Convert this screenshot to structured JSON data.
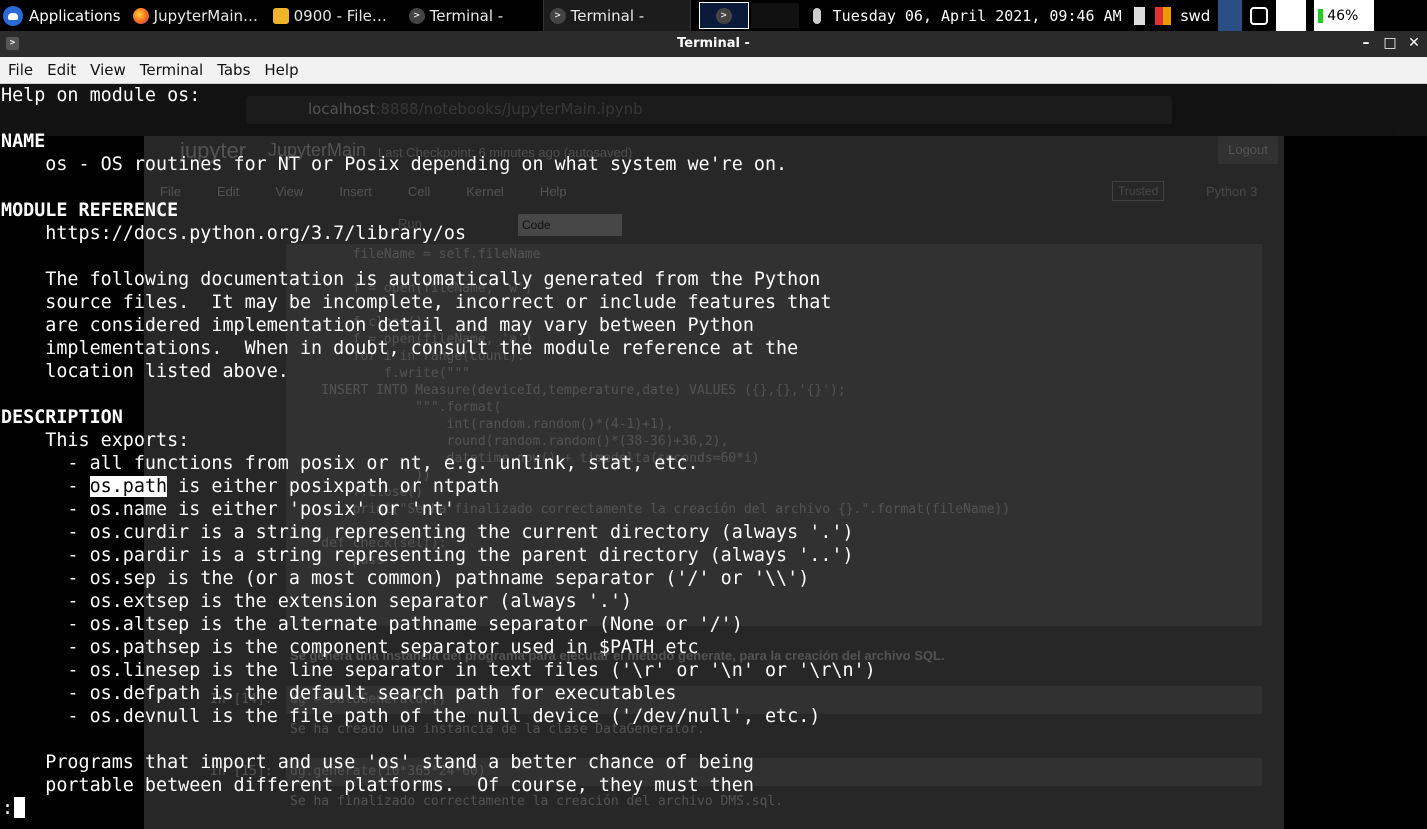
{
  "panel": {
    "applications_label": "Applications",
    "tasks": [
      {
        "label": "JupyterMain…",
        "icon": "firefox-icon"
      },
      {
        "label": "0900 - File…",
        "icon": "folder-icon"
      },
      {
        "label": "Terminal -",
        "icon": "terminal-icon"
      },
      {
        "label": "Terminal -",
        "icon": "terminal-icon"
      }
    ],
    "clock": "Tuesday 06, April 2021, 09:46 AM",
    "user": "swd",
    "battery": "46%"
  },
  "window": {
    "title": "Terminal -",
    "minimize_glyph": "–",
    "maximize_glyph": "□",
    "close_glyph": "✕"
  },
  "menu": {
    "file": "File",
    "edit": "Edit",
    "view": "View",
    "terminal": "Terminal",
    "tabs": "Tabs",
    "help": "Help"
  },
  "background_browser": {
    "url_host": "localhost",
    "url_rest": ":8888/notebooks/JupyterMain.ipynb",
    "brand": "jupyter",
    "notebook_name": "JupyterMain",
    "checkpoint": "Last Checkpoint: 6 minutes ago  (autosaved)",
    "logout": "Logout",
    "nb_menu": [
      "File",
      "Edit",
      "View",
      "Insert",
      "Cell",
      "Kernel",
      "Help"
    ],
    "trusted": "Trusted",
    "kernel": "Python 3",
    "run_label": "Run",
    "cell_type": "Code",
    "code": "        fileName = self.fileName\n\n        f = open(fileName, 'w')\n\n        f.close()\n        f = open(fileName, 'a')\n        for i in range(count):\n            f.write(\"\"\"\n    INSERT INTO Measure(deviceId,temperature,date) VALUES ({},{},'{}');\n                \"\"\".format(\n                    int(random.random()*(4-1)+1),\n                    round(random.random()*(38-36)+36,2),\n                    datetime.now() + timedelta(seconds=60*i)\n                ))\n        f.close()\n        print(\"Se ha finalizado correctamente la creación del archivo {}.\".format(fileName))\n\n    def check(self):\n        pass",
    "markdown": "Se genera una instancia del programa para ejecutar el método generate, para la creación del archivo SQL.",
    "in14_prompt": "In [14]:",
    "in14_code": "dg = DataGenerator()",
    "out14": "Se ha creado una instancia de la clase DataGenerator.",
    "in15_prompt": "In [15]:",
    "in15_code": "dg.generate(10*365*24*60)",
    "out15": "Se ha finalizado correctamente la creación del archivo DMS.sql."
  },
  "man_page": {
    "lines": [
      {
        "text": "Help on module os:",
        "bold": false
      },
      {
        "text": "",
        "bold": false
      },
      {
        "text": "NAME",
        "bold": true
      },
      {
        "text": "    os - OS routines for NT or Posix depending on what system we're on.",
        "bold": false
      },
      {
        "text": "",
        "bold": false
      },
      {
        "text": "MODULE REFERENCE",
        "bold": true
      },
      {
        "text": "    https://docs.python.org/3.7/library/os",
        "bold": false
      },
      {
        "text": "",
        "bold": false
      },
      {
        "text": "    The following documentation is automatically generated from the Python",
        "bold": false
      },
      {
        "text": "    source files.  It may be incomplete, incorrect or include features that",
        "bold": false
      },
      {
        "text": "    are considered implementation detail and may vary between Python",
        "bold": false
      },
      {
        "text": "    implementations.  When in doubt, consult the module reference at the",
        "bold": false
      },
      {
        "text": "    location listed above.",
        "bold": false
      },
      {
        "text": "",
        "bold": false
      },
      {
        "text": "DESCRIPTION",
        "bold": true
      },
      {
        "text": "    This exports:",
        "bold": false
      },
      {
        "text": "      - all functions from posix or nt, e.g. unlink, stat, etc.",
        "bold": false
      },
      {
        "text": "      - os.path is either posixpath or ntpath",
        "bold": false,
        "highlight": "os.path"
      },
      {
        "text": "      - os.name is either 'posix' or 'nt'",
        "bold": false
      },
      {
        "text": "      - os.curdir is a string representing the current directory (always '.')",
        "bold": false
      },
      {
        "text": "      - os.pardir is a string representing the parent directory (always '..')",
        "bold": false
      },
      {
        "text": "      - os.sep is the (or a most common) pathname separator ('/' or '\\\\')",
        "bold": false
      },
      {
        "text": "      - os.extsep is the extension separator (always '.')",
        "bold": false
      },
      {
        "text": "      - os.altsep is the alternate pathname separator (None or '/')",
        "bold": false
      },
      {
        "text": "      - os.pathsep is the component separator used in $PATH etc",
        "bold": false
      },
      {
        "text": "      - os.linesep is the line separator in text files ('\\r' or '\\n' or '\\r\\n')",
        "bold": false
      },
      {
        "text": "      - os.defpath is the default search path for executables",
        "bold": false
      },
      {
        "text": "      - os.devnull is the file path of the null device ('/dev/null', etc.)",
        "bold": false
      },
      {
        "text": "",
        "bold": false
      },
      {
        "text": "    Programs that import and use 'os' stand a better chance of being",
        "bold": false
      },
      {
        "text": "    portable between different platforms.  Of course, they must then",
        "bold": false
      }
    ],
    "pager_prompt": ":"
  },
  "colors": {
    "terminal_bg": "#000000",
    "terminal_fg": "#ffffff",
    "menubar_bg": "#f2f2f2",
    "titlebar_bg": "#2b2b2b"
  }
}
